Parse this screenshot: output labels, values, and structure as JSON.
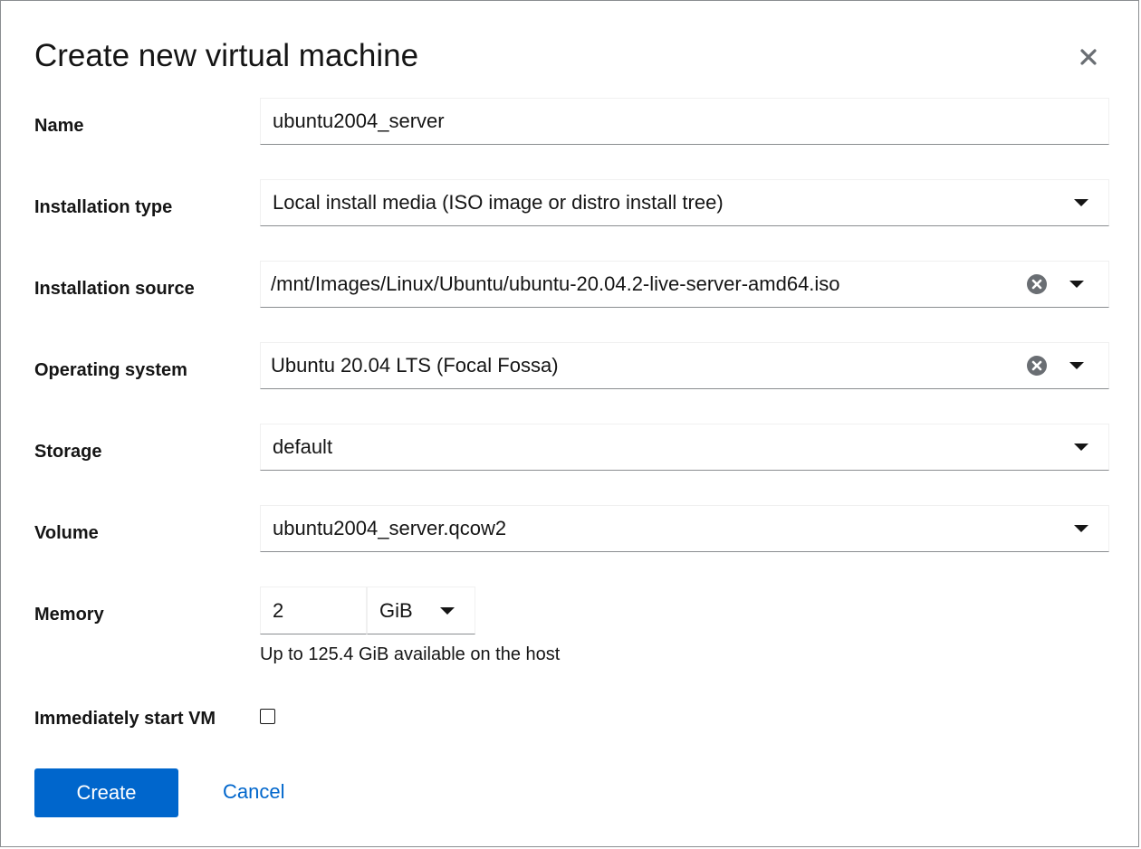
{
  "dialog": {
    "title": "Create new virtual machine"
  },
  "fields": {
    "name": {
      "label": "Name",
      "value": "ubuntu2004_server"
    },
    "installation_type": {
      "label": "Installation type",
      "value": "Local install media (ISO image or distro install tree)"
    },
    "installation_source": {
      "label": "Installation source",
      "value": "/mnt/Images/Linux/Ubuntu/ubuntu-20.04.2-live-server-amd64.iso"
    },
    "operating_system": {
      "label": "Operating system",
      "value": "Ubuntu 20.04 LTS (Focal Fossa)"
    },
    "storage": {
      "label": "Storage",
      "value": "default"
    },
    "volume": {
      "label": "Volume",
      "value": "ubuntu2004_server.qcow2"
    },
    "memory": {
      "label": "Memory",
      "value": "2",
      "unit": "GiB",
      "helper": "Up to 125.4 GiB available on the host"
    },
    "start_vm": {
      "label": "Immediately start VM",
      "checked": false
    }
  },
  "actions": {
    "create_label": "Create",
    "cancel_label": "Cancel"
  },
  "colors": {
    "primary": "#0066cc",
    "text": "#151515",
    "border": "#8a8d90"
  },
  "icons": {
    "close": "close-icon",
    "clear": "clear-circle-icon",
    "dropdown": "caret-down-icon"
  }
}
